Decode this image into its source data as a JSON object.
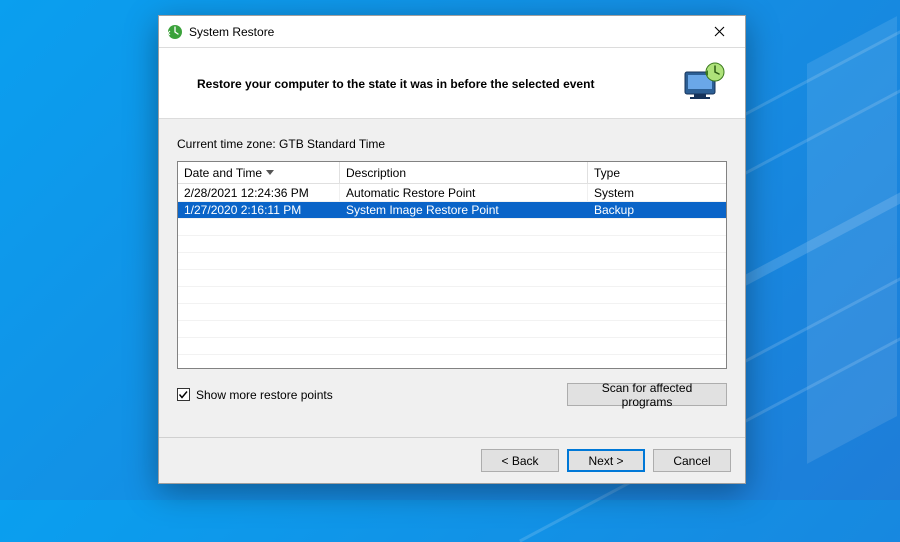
{
  "titlebar": {
    "title": "System Restore"
  },
  "header": {
    "heading": "Restore your computer to the state it was in before the selected event"
  },
  "timezone_label": "Current time zone: GTB Standard Time",
  "columns": {
    "date": "Date and Time",
    "desc": "Description",
    "type": "Type"
  },
  "rows": [
    {
      "date": "2/28/2021 12:24:36 PM",
      "desc": "Automatic Restore Point",
      "type": "System",
      "selected": false
    },
    {
      "date": "1/27/2020 2:16:11 PM",
      "desc": "System Image Restore Point",
      "type": "Backup",
      "selected": true
    }
  ],
  "show_more": {
    "label": "Show more restore points",
    "checked": true
  },
  "buttons": {
    "scan": "Scan for affected programs",
    "back": "< Back",
    "next": "Next >",
    "cancel": "Cancel"
  }
}
